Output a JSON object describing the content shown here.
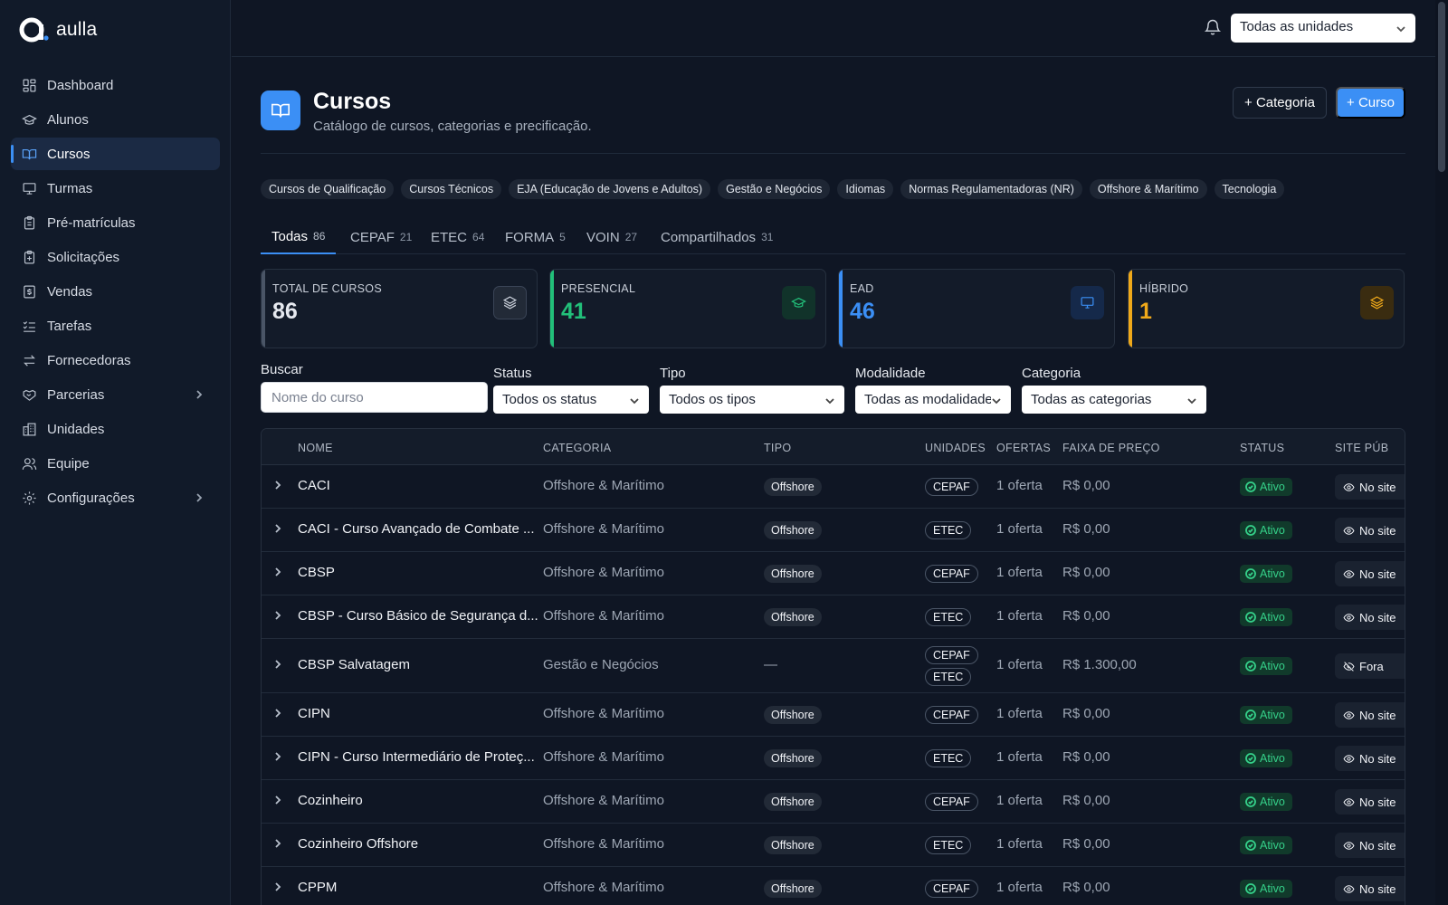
{
  "brand": {
    "name": "aulla"
  },
  "sidebar": {
    "items": [
      {
        "label": "Dashboard",
        "icon": "dashboard-icon"
      },
      {
        "label": "Alunos",
        "icon": "graduation-cap-icon"
      },
      {
        "label": "Cursos",
        "icon": "book-open-icon",
        "active": true
      },
      {
        "label": "Turmas",
        "icon": "presentation-icon"
      },
      {
        "label": "Pré-matrículas",
        "icon": "clipboard-icon"
      },
      {
        "label": "Solicitações",
        "icon": "clipboard-plus-icon"
      },
      {
        "label": "Vendas",
        "icon": "receipt-icon"
      },
      {
        "label": "Tarefas",
        "icon": "list-checks-icon"
      },
      {
        "label": "Fornecedoras",
        "icon": "arrows-swap-icon"
      },
      {
        "label": "Parcerias",
        "icon": "handshake-icon",
        "expandable": true
      },
      {
        "label": "Unidades",
        "icon": "building-icon"
      },
      {
        "label": "Equipe",
        "icon": "users-icon"
      },
      {
        "label": "Configurações",
        "icon": "gear-icon",
        "expandable": true
      }
    ]
  },
  "topbar": {
    "unit_select": "Todas as unidades"
  },
  "header": {
    "title": "Cursos",
    "subtitle": "Catálogo de cursos, categorias e precificação.",
    "btn_category": "+ Categoria",
    "btn_course": "+ Curso"
  },
  "category_chips": [
    "Cursos de Qualificação",
    "Cursos Técnicos",
    "EJA (Educação de Jovens e Adultos)",
    "Gestão e Negócios",
    "Idiomas",
    "Normas Regulamentadoras (NR)",
    "Offshore & Marítimo",
    "Tecnologia"
  ],
  "tabs": [
    {
      "label": "Todas",
      "count": "86",
      "active": true
    },
    {
      "label": "CEPAF",
      "count": "21"
    },
    {
      "label": "ETEC",
      "count": "64"
    },
    {
      "label": "FORMA",
      "count": "5"
    },
    {
      "label": "VOIN",
      "count": "27"
    },
    {
      "label": "Compartilhados",
      "count": "31"
    }
  ],
  "stats": [
    {
      "label": "TOTAL DE CURSOS",
      "value": "86",
      "color": "#e6e9ef",
      "bar": "#4a5566",
      "icon": "layers-icon"
    },
    {
      "label": "PRESENCIAL",
      "value": "41",
      "color": "#22c07a",
      "bar": "#22c07a",
      "icon": "graduation-cap-icon"
    },
    {
      "label": "EAD",
      "value": "46",
      "color": "#3b8ff5",
      "bar": "#3b8ff5",
      "icon": "monitor-icon"
    },
    {
      "label": "HÍBRIDO",
      "value": "1",
      "color": "#f0a91a",
      "bar": "#f0a91a",
      "icon": "layers-icon"
    }
  ],
  "filters": {
    "search_label": "Buscar",
    "search_placeholder": "Nome do curso",
    "status_label": "Status",
    "status_value": "Todos os status",
    "tipo_label": "Tipo",
    "tipo_value": "Todos os tipos",
    "modalidade_label": "Modalidade",
    "modalidade_value": "Todas as modalidades",
    "categoria_label": "Categoria",
    "categoria_value": "Todas as categorias"
  },
  "table": {
    "headers": {
      "nome": "NOME",
      "categoria": "CATEGORIA",
      "tipo": "TIPO",
      "unidades": "UNIDADES",
      "ofertas": "OFERTAS",
      "preco": "FAIXA DE PREÇO",
      "status": "STATUS",
      "site": "SITE PÚB"
    },
    "rows": [
      {
        "nome": "CACI",
        "categoria": "Offshore & Marítimo",
        "tipo": "Offshore",
        "unidades": [
          "CEPAF"
        ],
        "ofertas": "1 oferta",
        "preco": "R$ 0,00",
        "status": "Ativo",
        "site": "No site",
        "site_icon": "eye-icon"
      },
      {
        "nome": "CACI - Curso Avançado de Combate ...",
        "categoria": "Offshore & Marítimo",
        "tipo": "Offshore",
        "unidades": [
          "ETEC"
        ],
        "ofertas": "1 oferta",
        "preco": "R$ 0,00",
        "status": "Ativo",
        "site": "No site",
        "site_icon": "eye-icon"
      },
      {
        "nome": "CBSP",
        "categoria": "Offshore & Marítimo",
        "tipo": "Offshore",
        "unidades": [
          "CEPAF"
        ],
        "ofertas": "1 oferta",
        "preco": "R$ 0,00",
        "status": "Ativo",
        "site": "No site",
        "site_icon": "eye-icon"
      },
      {
        "nome": "CBSP - Curso Básico de Segurança d...",
        "categoria": "Offshore & Marítimo",
        "tipo": "Offshore",
        "unidades": [
          "ETEC"
        ],
        "ofertas": "1 oferta",
        "preco": "R$ 0,00",
        "status": "Ativo",
        "site": "No site",
        "site_icon": "eye-icon"
      },
      {
        "nome": "CBSP Salvatagem",
        "categoria": "Gestão e Negócios",
        "tipo": "—",
        "unidades": [
          "CEPAF",
          "ETEC"
        ],
        "ofertas": "1 oferta",
        "preco": "R$ 1.300,00",
        "status": "Ativo",
        "site": "Fora",
        "site_icon": "eye-off-icon"
      },
      {
        "nome": "CIPN",
        "categoria": "Offshore & Marítimo",
        "tipo": "Offshore",
        "unidades": [
          "CEPAF"
        ],
        "ofertas": "1 oferta",
        "preco": "R$ 0,00",
        "status": "Ativo",
        "site": "No site",
        "site_icon": "eye-icon"
      },
      {
        "nome": "CIPN - Curso Intermediário de Proteç...",
        "categoria": "Offshore & Marítimo",
        "tipo": "Offshore",
        "unidades": [
          "ETEC"
        ],
        "ofertas": "1 oferta",
        "preco": "R$ 0,00",
        "status": "Ativo",
        "site": "No site",
        "site_icon": "eye-icon"
      },
      {
        "nome": "Cozinheiro",
        "categoria": "Offshore & Marítimo",
        "tipo": "Offshore",
        "unidades": [
          "CEPAF"
        ],
        "ofertas": "1 oferta",
        "preco": "R$ 0,00",
        "status": "Ativo",
        "site": "No site",
        "site_icon": "eye-icon"
      },
      {
        "nome": "Cozinheiro Offshore",
        "categoria": "Offshore & Marítimo",
        "tipo": "Offshore",
        "unidades": [
          "ETEC"
        ],
        "ofertas": "1 oferta",
        "preco": "R$ 0,00",
        "status": "Ativo",
        "site": "No site",
        "site_icon": "eye-icon"
      },
      {
        "nome": "CPPM",
        "categoria": "Offshore & Marítimo",
        "tipo": "Offshore",
        "unidades": [
          "CEPAF"
        ],
        "ofertas": "1 oferta",
        "preco": "R$ 0,00",
        "status": "Ativo",
        "site": "No site",
        "site_icon": "eye-icon"
      }
    ]
  }
}
